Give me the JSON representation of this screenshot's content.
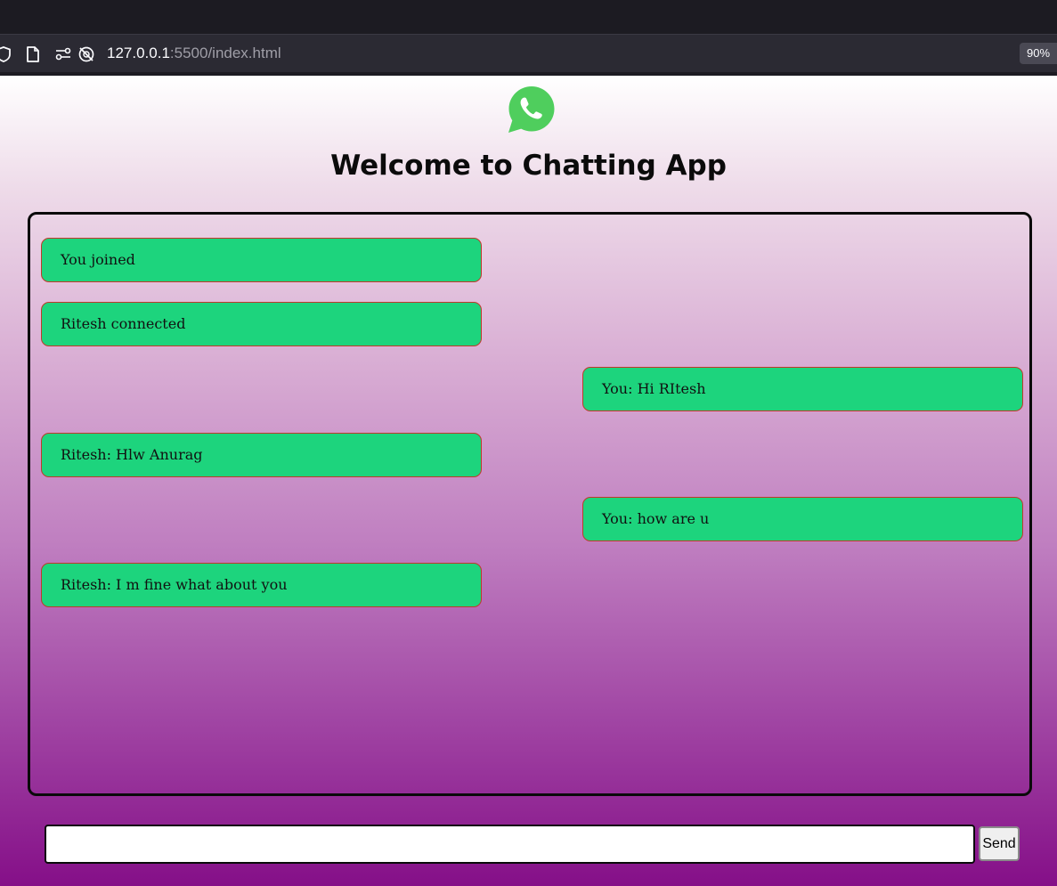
{
  "browser": {
    "url_host": "127.0.0.1",
    "url_rest": ":5500/index.html",
    "zoom": "90%",
    "icons": [
      "shield-icon",
      "page-icon",
      "permissions-icon",
      "tracking-off-icon"
    ]
  },
  "page": {
    "logo_icon": "whatsapp-logo-icon",
    "title": "Welcome to Chatting App",
    "colors": {
      "message_bg": "#1dd47d",
      "message_border": "#c0392b",
      "gradient_top": "#ffffff",
      "gradient_bottom": "#850f88"
    }
  },
  "messages": [
    {
      "text": "You joined",
      "side": "left"
    },
    {
      "text": "Ritesh connected",
      "side": "left"
    },
    {
      "text": "You: Hi RItesh",
      "side": "right"
    },
    {
      "text": "Ritesh: Hlw Anurag",
      "side": "left"
    },
    {
      "text": "You: how are u",
      "side": "right"
    },
    {
      "text": "Ritesh: I m fine what about you",
      "side": "left"
    }
  ],
  "composer": {
    "input_value": "",
    "send_label": "Send"
  }
}
